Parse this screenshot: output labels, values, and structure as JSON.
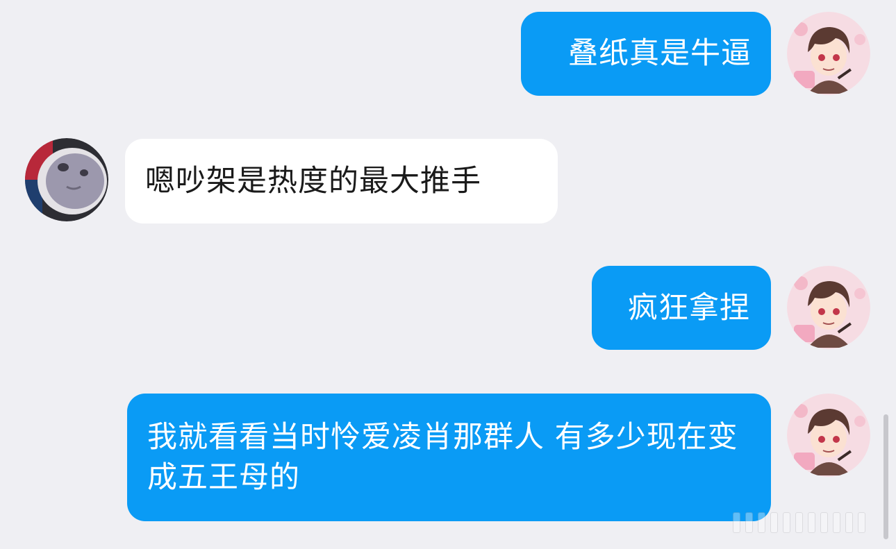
{
  "messages": [
    {
      "side": "outgoing",
      "text": "叠纸真是牛逼",
      "avatar": "user-anime-avatar"
    },
    {
      "side": "incoming",
      "text": "嗯吵架是热度的最大推手",
      "avatar": "contact-plush-avatar"
    },
    {
      "side": "outgoing",
      "text": "疯狂拿捏",
      "avatar": "user-anime-avatar"
    },
    {
      "side": "outgoing",
      "text": "我就看看当时怜爱凌肖那群人 有多少现在变成五王母的",
      "avatar": "user-anime-avatar"
    }
  ],
  "colors": {
    "background": "#efeff3",
    "outgoing_bubble": "#0a9bf5",
    "incoming_bubble": "#ffffff"
  }
}
